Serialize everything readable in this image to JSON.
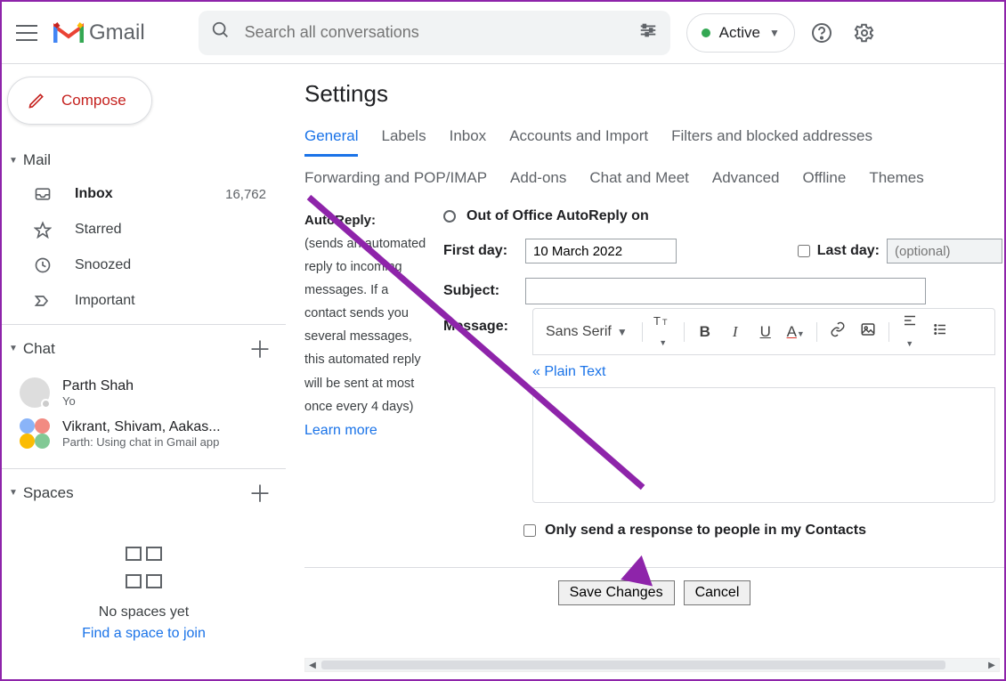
{
  "header": {
    "product": "Gmail",
    "search_placeholder": "Search all conversations",
    "status_label": "Active"
  },
  "sidebar": {
    "compose_label": "Compose",
    "mail": {
      "title": "Mail"
    },
    "nav": {
      "inbox": {
        "label": "Inbox",
        "count": "16,762"
      },
      "starred": {
        "label": "Starred"
      },
      "snoozed": {
        "label": "Snoozed"
      },
      "important": {
        "label": "Important"
      }
    },
    "chat": {
      "title": "Chat"
    },
    "chats": [
      {
        "name": "Parth Shah",
        "sub": "Yo"
      },
      {
        "name": "Vikrant, Shivam, Aakas...",
        "sub": "Parth: Using chat in Gmail app"
      }
    ],
    "spaces": {
      "title": "Spaces",
      "empty": "No spaces yet",
      "find_link": "Find a space to join"
    }
  },
  "settings": {
    "title": "Settings",
    "tabs1": [
      "General",
      "Labels",
      "Inbox",
      "Accounts and Import",
      "Filters and blocked addresses"
    ],
    "tabs2": [
      "Forwarding and POP/IMAP",
      "Add-ons",
      "Chat and Meet",
      "Advanced",
      "Offline",
      "Themes"
    ],
    "autoreply": {
      "label": "AutoReply:",
      "desc": "(sends an automated reply to incoming messages. If a contact sends you several messages, this automated reply will be sent at most once every 4 days)",
      "learn": "Learn more",
      "on_label": "Out of Office AutoReply on",
      "first_day_label": "First day:",
      "first_day_value": "10 March 2022",
      "last_day_label": "Last day:",
      "last_day_placeholder": "(optional)",
      "subject_label": "Subject:",
      "message_label": "Message:",
      "font": "Sans Serif",
      "plain_text": "« Plain Text",
      "only_contacts": "Only send a response to people in my Contacts"
    },
    "save_label": "Save Changes",
    "cancel_label": "Cancel"
  }
}
